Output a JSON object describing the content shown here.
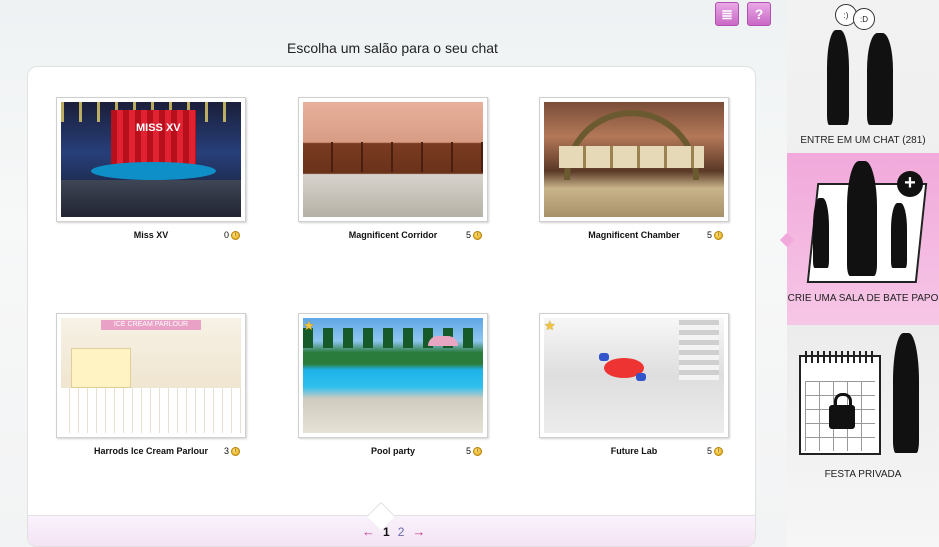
{
  "header": {
    "title": "Escolha um salão para o seu chat",
    "icons": [
      "list-check-icon",
      "help-icon"
    ],
    "help_glyph": "?"
  },
  "rooms": [
    {
      "name": "Miss XV",
      "count": "0",
      "thumb": "miss",
      "featured": false
    },
    {
      "name": "Magnificent Corridor",
      "count": "5",
      "thumb": "corridor",
      "featured": false
    },
    {
      "name": "Magnificent Chamber",
      "count": "5",
      "thumb": "chamber",
      "featured": false
    },
    {
      "name": "Harrods Ice Cream Parlour",
      "count": "3",
      "thumb": "parlour",
      "featured": false
    },
    {
      "name": "Pool party",
      "count": "5",
      "thumb": "pool",
      "featured": true
    },
    {
      "name": "Future Lab",
      "count": "5",
      "thumb": "lab",
      "featured": true
    }
  ],
  "thumb_text": {
    "miss": "MISS XV",
    "parlour": "ICE CREAM PARLOUR"
  },
  "pagination": {
    "prev": "←",
    "pages": [
      "1",
      "2"
    ],
    "current": "1",
    "next": "→"
  },
  "sidebar": {
    "enter_chat": "ENTRE EM UM CHAT (281)",
    "create_room": "CRIE UMA SALA DE BATE PAPO",
    "private_party": "FESTA PRIVADA",
    "bubble_1": ":)",
    "bubble_2": ":D",
    "plus": "+"
  },
  "colors": {
    "accent_pink": "#f1a9db",
    "arrow": "#c1378f",
    "coin": "#d9a011"
  }
}
